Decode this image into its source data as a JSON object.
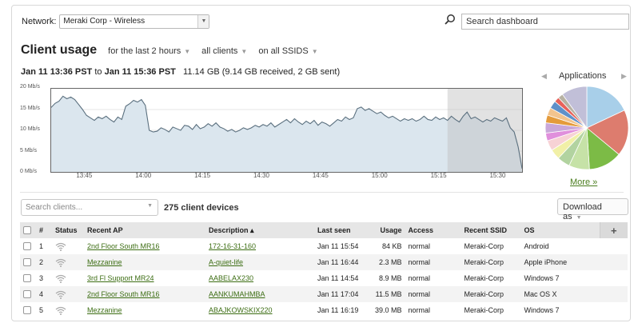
{
  "network": {
    "label": "Network:",
    "selected": "Meraki Corp - Wireless"
  },
  "search": {
    "placeholder": "Search dashboard"
  },
  "page": {
    "title": "Client usage",
    "filter_time": "for the last 2 hours",
    "filter_clients": "all clients",
    "filter_ssids": "on all SSIDS"
  },
  "range": {
    "start": "Jan 11 13:36 PST",
    "to": "to",
    "end": "Jan 11 15:36 PST",
    "total": "11.14 GB (9.14 GB received, 2 GB sent)"
  },
  "chart_data": {
    "type": "area",
    "ylabel_ticks": [
      "20 Mb/s",
      "15 Mb/s",
      "10 Mb/s",
      "5 Mb/s",
      "0 Mb/s"
    ],
    "ylim": [
      0,
      20
    ],
    "xlim_minutes": [
      0,
      120
    ],
    "x_ticks": [
      "13:45",
      "14:00",
      "14:15",
      "14:30",
      "14:45",
      "15:00",
      "15:15",
      "15:30"
    ],
    "x_tick_minutes": [
      9,
      24,
      39,
      54,
      69,
      84,
      99,
      114
    ],
    "series": [
      {
        "x_minutes": [
          0,
          1,
          2,
          3,
          4,
          5,
          6,
          7,
          8,
          9,
          10,
          11,
          12,
          13,
          14,
          15,
          16,
          17,
          18,
          19,
          20,
          21,
          22,
          23,
          24,
          25,
          26,
          27,
          28,
          29,
          30,
          31,
          32,
          33,
          34,
          35,
          36,
          37,
          38,
          39,
          40,
          41,
          42,
          43,
          44,
          45,
          46,
          47,
          48,
          49,
          50,
          51,
          52,
          53,
          54,
          55,
          56,
          57,
          58,
          59,
          60,
          61,
          62,
          63,
          64,
          65,
          66,
          67,
          68,
          69,
          70,
          71,
          72,
          73,
          74,
          75,
          76,
          77,
          78,
          79,
          80,
          81,
          82,
          83,
          84,
          85,
          86,
          87,
          88,
          89,
          90,
          91,
          92,
          93,
          94,
          95,
          96,
          97,
          98,
          99,
          100,
          101,
          102,
          103,
          104,
          105,
          106,
          107,
          108,
          109,
          110,
          111,
          112,
          113,
          114,
          115,
          116,
          117,
          118,
          119,
          120
        ],
        "values": [
          15.5,
          16.5,
          17.0,
          18.2,
          17.6,
          18.0,
          17.4,
          16.2,
          15.0,
          13.6,
          13.0,
          12.4,
          13.2,
          12.8,
          13.4,
          12.6,
          12.0,
          13.2,
          12.6,
          15.8,
          16.4,
          17.2,
          16.8,
          17.4,
          16.0,
          10.0,
          9.6,
          9.8,
          10.6,
          10.2,
          9.6,
          10.8,
          10.4,
          10.0,
          11.2,
          11.0,
          10.2,
          11.4,
          10.4,
          10.8,
          11.6,
          11.0,
          11.8,
          10.8,
          10.4,
          9.8,
          10.2,
          9.6,
          10.0,
          10.6,
          10.2,
          10.6,
          11.2,
          10.8,
          11.4,
          11.0,
          11.8,
          10.8,
          11.4,
          12.0,
          12.6,
          11.8,
          12.8,
          12.0,
          11.4,
          12.2,
          11.6,
          12.4,
          11.2,
          12.0,
          11.6,
          11.0,
          11.8,
          12.6,
          12.2,
          13.2,
          12.6,
          13.0,
          15.2,
          15.6,
          14.8,
          15.2,
          14.6,
          14.0,
          14.4,
          13.6,
          13.0,
          13.4,
          12.8,
          12.2,
          12.8,
          12.4,
          12.8,
          12.2,
          12.6,
          13.4,
          12.6,
          12.4,
          13.2,
          12.6,
          13.0,
          12.4,
          13.4,
          12.6,
          12.0,
          13.4,
          14.4,
          12.8,
          13.2,
          12.6,
          12.0,
          12.6,
          12.2,
          13.0,
          12.6,
          12.2,
          13.0,
          10.6,
          9.6,
          6.0,
          0.8
        ]
      }
    ],
    "shaded_region_minutes": [
      101,
      120
    ]
  },
  "applications": {
    "title": "Applications",
    "more_link": "More »",
    "slices": [
      {
        "color": "#a8cfe9",
        "value": 18
      },
      {
        "color": "#dd7c6e",
        "value": 18
      },
      {
        "color": "#7cbb46",
        "value": 13
      },
      {
        "color": "#c6e2a7",
        "value": 8
      },
      {
        "color": "#b2d3a0",
        "value": 5
      },
      {
        "color": "#f1f0a7",
        "value": 4
      },
      {
        "color": "#f7d2d5",
        "value": 4
      },
      {
        "color": "#e08fdc",
        "value": 3
      },
      {
        "color": "#c9a7d9",
        "value": 4
      },
      {
        "color": "#e49b3b",
        "value": 3
      },
      {
        "color": "#f2c48e",
        "value": 3
      },
      {
        "color": "#5f91c9",
        "value": 3
      },
      {
        "color": "#e8625a",
        "value": 2
      },
      {
        "color": "#b7b2a3",
        "value": 2
      },
      {
        "color": "#c1bfd8",
        "value": 10
      }
    ]
  },
  "clients": {
    "search_placeholder": "Search clients...",
    "count_text": "275 client devices",
    "download_label": "Download as",
    "columns": [
      "#",
      "Status",
      "Recent AP",
      "Description ▴",
      "Last seen",
      "Usage",
      "Access",
      "Recent SSID",
      "OS"
    ],
    "add_column": "+",
    "rows": [
      {
        "num": "1",
        "ap": "2nd Floor South MR16",
        "desc": "172-16-31-160",
        "seen": "Jan 11 15:54",
        "usage": "84 KB",
        "access": "normal",
        "ssid": "Meraki-Corp",
        "os": "Android"
      },
      {
        "num": "2",
        "ap": "Mezzanine",
        "desc": "A-quiet-life",
        "seen": "Jan 11 16:44",
        "usage": "2.3 MB",
        "access": "normal",
        "ssid": "Meraki-Corp",
        "os": "Apple iPhone"
      },
      {
        "num": "3",
        "ap": "3rd Fl Support MR24",
        "desc": "AABELAX230",
        "seen": "Jan 11 14:54",
        "usage": "8.9 MB",
        "access": "normal",
        "ssid": "Meraki-Corp",
        "os": "Windows 7"
      },
      {
        "num": "4",
        "ap": "2nd Floor South MR16",
        "desc": "AANKUMAHMBA",
        "seen": "Jan 11 17:04",
        "usage": "11.5 MB",
        "access": "normal",
        "ssid": "Meraki-Corp",
        "os": "Mac OS X"
      },
      {
        "num": "5",
        "ap": "Mezzanine",
        "desc": "ABAJKOWSKIX220",
        "seen": "Jan 11 16:19",
        "usage": "39.0 MB",
        "access": "normal",
        "ssid": "Meraki-Corp",
        "os": "Windows 7"
      }
    ]
  }
}
